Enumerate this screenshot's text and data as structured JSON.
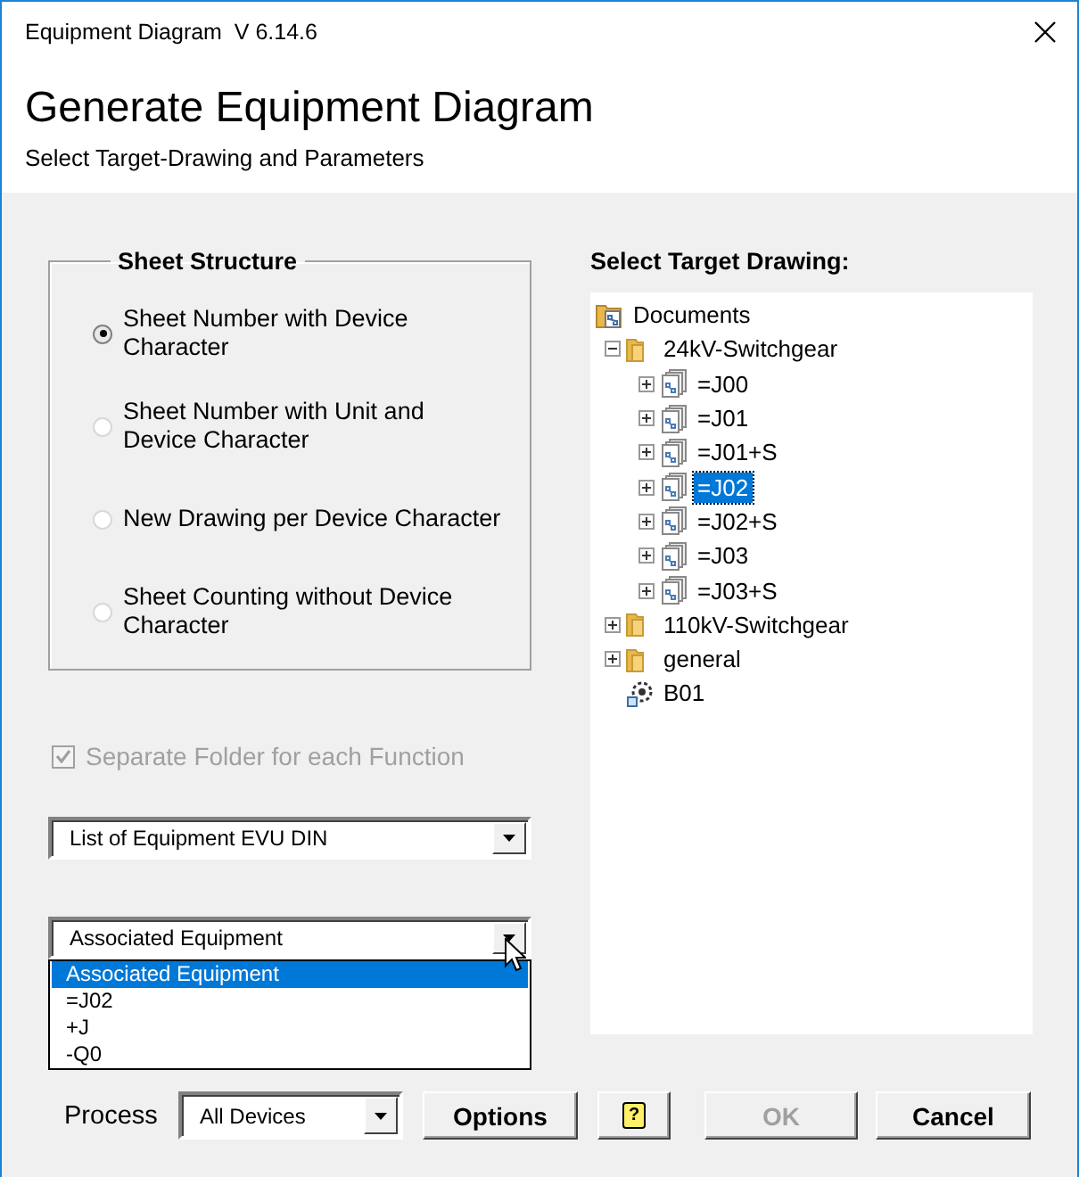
{
  "window": {
    "title": "Equipment Diagram  V 6.14.6"
  },
  "header": {
    "title": "Generate Equipment Diagram",
    "subtitle": "Select Target-Drawing and Parameters"
  },
  "sheet_structure": {
    "title": "Sheet Structure",
    "options": [
      {
        "label": "Sheet Number with Device Character",
        "selected": true
      },
      {
        "label": "Sheet Number with Unit and Device Character",
        "selected": false
      },
      {
        "label": "New Drawing per Device Character",
        "selected": false
      },
      {
        "label": "Sheet Counting without Device Character",
        "selected": false
      }
    ]
  },
  "separate_folder": {
    "label": "Separate Folder for each Function",
    "checked": true,
    "disabled": true
  },
  "list_combo": {
    "value": "List of Equipment EVU DIN"
  },
  "equipment_combo": {
    "value": "Associated Equipment",
    "expanded": true,
    "options": [
      {
        "label": "Associated Equipment",
        "selected": true
      },
      {
        "label": "=J02",
        "selected": false
      },
      {
        "label": "+J",
        "selected": false
      },
      {
        "label": "-Q0",
        "selected": false
      }
    ]
  },
  "target": {
    "title": "Select Target Drawing:",
    "tree": [
      {
        "label": "Documents",
        "kind": "root",
        "selected": false,
        "children": [
          {
            "label": "24kV-Switchgear",
            "kind": "folder",
            "selected": false,
            "expanded": true,
            "children": [
              {
                "label": "=J00",
                "kind": "unit",
                "selected": false,
                "expanded": false
              },
              {
                "label": "=J01",
                "kind": "unit",
                "selected": false,
                "expanded": false
              },
              {
                "label": "=J01+S",
                "kind": "unit",
                "selected": false,
                "expanded": false
              },
              {
                "label": "=J02",
                "kind": "unit",
                "selected": true,
                "expanded": false
              },
              {
                "label": "=J02+S",
                "kind": "unit",
                "selected": false,
                "expanded": false
              },
              {
                "label": "=J03",
                "kind": "unit",
                "selected": false,
                "expanded": false
              },
              {
                "label": "=J03+S",
                "kind": "unit",
                "selected": false,
                "expanded": false
              }
            ]
          },
          {
            "label": "110kV-Switchgear",
            "kind": "folder",
            "selected": false,
            "expanded": false
          },
          {
            "label": "general",
            "kind": "folder",
            "selected": false,
            "expanded": false
          },
          {
            "label": "B01",
            "kind": "device",
            "selected": false
          }
        ]
      }
    ]
  },
  "process": {
    "label": "Process",
    "value": "All Devices"
  },
  "buttons": [
    {
      "kind": "text",
      "label": "Options",
      "disabled": false
    },
    {
      "kind": "help",
      "label": "?",
      "disabled": false
    },
    {
      "kind": "text",
      "label": "OK",
      "disabled": true
    },
    {
      "kind": "text",
      "label": "Cancel",
      "disabled": false
    }
  ]
}
